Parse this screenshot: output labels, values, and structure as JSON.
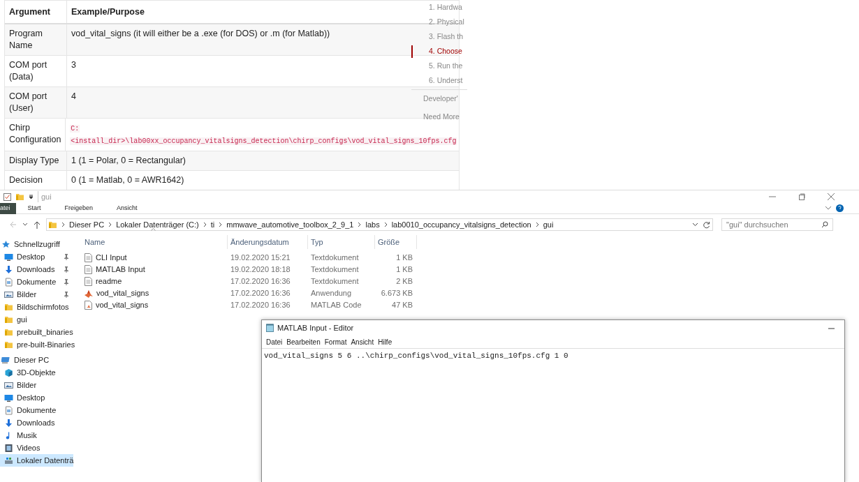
{
  "doc_table": {
    "columns": [
      "Argument",
      "Example/Purpose"
    ],
    "rows": [
      {
        "argument": "Program Name",
        "value": "vod_vital_signs (it will either be a .exe (for DOS) or .m (for Matlab))"
      },
      {
        "argument": "COM port (Data)",
        "value": "3"
      },
      {
        "argument": "COM port (User)",
        "value": "4"
      },
      {
        "argument": "Chirp Configuration",
        "code_lines": [
          "C:",
          "<install_dir>\\lab00xx_occupancy_vitalsigns_detection\\chirp_configs\\vod_vital_signs_10fps.cfg"
        ]
      },
      {
        "argument": "Display Type",
        "value": "1 (1 = Polar, 0 = Rectangular)"
      },
      {
        "argument": "Decision",
        "value": "0 (1 = Matlab, 0 = AWR1642)"
      }
    ]
  },
  "toc": {
    "steps": [
      {
        "label": "1. Hardwa",
        "selected": false
      },
      {
        "label": "2. Physical",
        "selected": false
      },
      {
        "label": "3. Flash th",
        "selected": false
      },
      {
        "label": "4. Choose",
        "selected": true
      },
      {
        "label": "5. Run the",
        "selected": false
      },
      {
        "label": "6. Underst",
        "selected": false
      }
    ],
    "links": [
      "Developer'",
      "Need More"
    ]
  },
  "explorer": {
    "title": "gui",
    "ribbon_tabs": [
      {
        "label": "atei",
        "selected": true
      },
      {
        "label": "Start",
        "selected": false
      },
      {
        "label": "Freigeben",
        "selected": false
      },
      {
        "label": "Ansicht",
        "selected": false
      }
    ],
    "breadcrumbs": [
      "Dieser PC",
      "Lokaler Datenträger (C:)",
      "ti",
      "mmwave_automotive_toolbox_2_9_1",
      "labs",
      "lab0010_occupancy_vitalsigns_detection",
      "gui"
    ],
    "search": {
      "placeholder": "\"gui\" durchsuchen"
    },
    "sidebar": [
      {
        "label": "Schnellzugriff",
        "kind": "star",
        "selected": false,
        "children": [
          {
            "label": "Desktop",
            "kind": "desktop",
            "pinned": true,
            "selected": false
          },
          {
            "label": "Downloads",
            "kind": "download",
            "pinned": true,
            "selected": false
          },
          {
            "label": "Dokumente",
            "kind": "document",
            "pinned": true,
            "selected": false
          },
          {
            "label": "Bilder",
            "kind": "pictures",
            "pinned": true,
            "selected": false
          },
          {
            "label": "Bildschirmfotos",
            "kind": "folder",
            "pinned": false,
            "selected": false
          },
          {
            "label": "gui",
            "kind": "folder",
            "pinned": false,
            "selected": false
          },
          {
            "label": "prebuilt_binaries",
            "kind": "folder",
            "pinned": false,
            "selected": false
          },
          {
            "label": "pre-built-Binaries",
            "kind": "folder",
            "pinned": false,
            "selected": false
          }
        ]
      },
      {
        "label": "Dieser PC",
        "kind": "pc",
        "selected": false,
        "children": [
          {
            "label": "3D-Objekte",
            "kind": "cube",
            "pinned": false,
            "selected": false
          },
          {
            "label": "Bilder",
            "kind": "pictures",
            "pinned": false,
            "selected": false
          },
          {
            "label": "Desktop",
            "kind": "desktop",
            "pinned": false,
            "selected": false
          },
          {
            "label": "Dokumente",
            "kind": "document",
            "pinned": false,
            "selected": false
          },
          {
            "label": "Downloads",
            "kind": "download",
            "pinned": false,
            "selected": false
          },
          {
            "label": "Musik",
            "kind": "music",
            "pinned": false,
            "selected": false
          },
          {
            "label": "Videos",
            "kind": "video",
            "pinned": false,
            "selected": false
          },
          {
            "label": "Lokaler Datenträ",
            "kind": "drive",
            "pinned": false,
            "selected": true
          }
        ]
      }
    ],
    "columns": [
      "Name",
      "Änderungsdatum",
      "Typ",
      "Größe"
    ],
    "files": [
      {
        "name": "CLI Input",
        "kind": "text",
        "modified": "19.02.2020 15:21",
        "type": "Textdokument",
        "size": "1 KB"
      },
      {
        "name": "MATLAB Input",
        "kind": "text",
        "modified": "19.02.2020 18:18",
        "type": "Textdokument",
        "size": "1 KB"
      },
      {
        "name": "readme",
        "kind": "text",
        "modified": "17.02.2020 16:36",
        "type": "Textdokument",
        "size": "2 KB"
      },
      {
        "name": "vod_vital_signs",
        "kind": "matlab_app",
        "modified": "17.02.2020 16:36",
        "type": "Anwendung",
        "size": "6.673 KB"
      },
      {
        "name": "vod_vital_signs",
        "kind": "matlab_code",
        "modified": "17.02.2020 16:36",
        "type": "MATLAB Code",
        "size": "47 KB"
      }
    ]
  },
  "editor": {
    "title": "MATLAB Input - Editor",
    "menu": [
      "Datei",
      "Bearbeiten",
      "Format",
      "Ansicht",
      "Hilfe"
    ],
    "content": "vod_vital_signs 5 6 ..\\chirp_configs\\vod_vital_signs_10fps.cfg 1 0"
  }
}
